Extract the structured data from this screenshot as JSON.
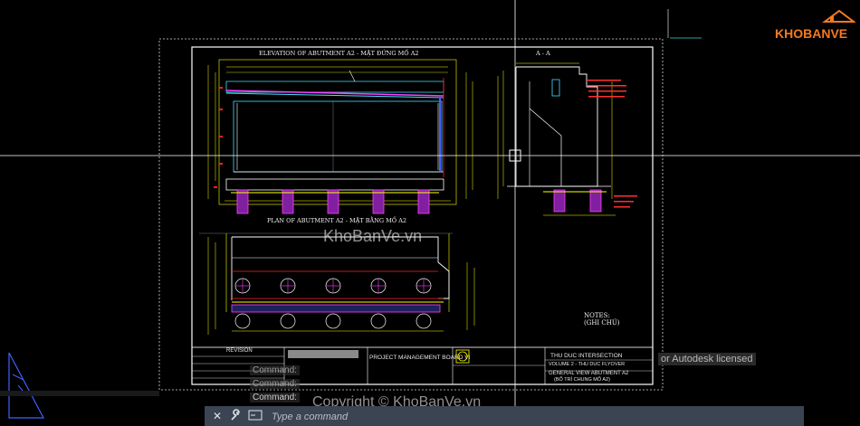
{
  "drawing": {
    "elevation_title": "ELEVATION OF ABUTMENT A2 - MẶT ĐỨNG MỐ A2",
    "plan_title": "PLAN OF ABUTMENT A2 - MẶT BẰNG MỐ A2",
    "section_title": "A - A",
    "notes_title": "NOTES:",
    "notes_sub": "(GHI CHÚ)",
    "revision_label": "REVISION",
    "project_name": "PROJECT MANAGEMENT BOARD VI",
    "project_title": "THU DUC INTERSECTION",
    "volume": "VOLUME 2 - THU DUC FLYOVER",
    "sheet_title": "GENERAL VIEW ABUTMENT A2",
    "sheet_subtitle": "(BỐ TRÍ CHUNG MỐ A2)"
  },
  "watermark": {
    "center": "KhoBanVe.vn",
    "bottom": "Copyright © KhoBanVe.vn"
  },
  "logo": {
    "text": "KHOBANVE"
  },
  "overlay": {
    "license_text": "or Autodesk licensed"
  },
  "command": {
    "history": [
      "Command:",
      "Command:",
      "Command:"
    ],
    "placeholder": "Type a command",
    "close_icon": "close-icon",
    "wrench_icon": "wrench-icon",
    "prompt_icon": "prompt-icon"
  },
  "colors": {
    "background": "#000000",
    "crosshair": "#ffffff",
    "sheet_border": "#ffffff",
    "dims": "#ffff00",
    "red": "#ff2020",
    "magenta": "#ff40ff",
    "cyan": "#40e0ff",
    "blue": "#4060ff",
    "green": "#20c040",
    "brand_orange": "#f47a20",
    "command_bar": "#3b4453"
  }
}
